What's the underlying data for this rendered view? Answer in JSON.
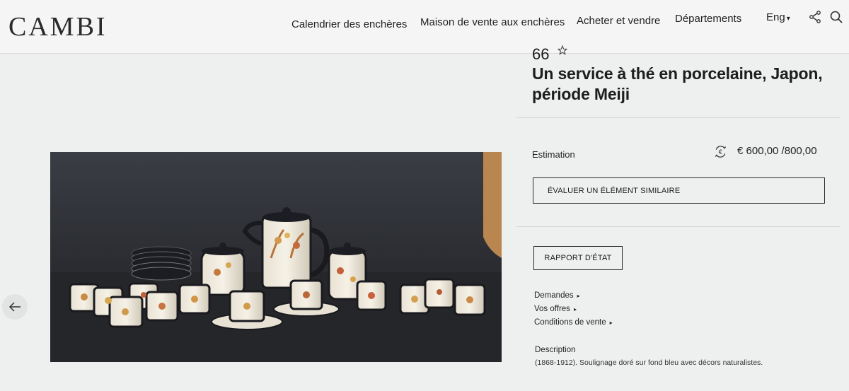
{
  "header": {
    "logo": "CAMBI",
    "nav": [
      {
        "label": "Calendrier des enchères"
      },
      {
        "label": "Maison de vente aux enchères"
      },
      {
        "label": "Acheter et vendre"
      },
      {
        "label": "Départements"
      }
    ],
    "language": "Eng",
    "icons": [
      "share-icon",
      "search-icon"
    ]
  },
  "lot": {
    "number": "66",
    "title": "Un service à thé en porcelaine, Japon, période Meiji",
    "estimate_label": "Estimation",
    "estimate_value": "€ 600,00 /800,00",
    "similar_button": "ÉVALUER UN ÉLÉMENT SIMILAIRE",
    "report_button": "RAPPORT D'ÉTAT",
    "links": [
      {
        "label": "Demandes"
      },
      {
        "label": "Vos offres"
      },
      {
        "label": "Conditions de vente"
      }
    ],
    "description_title": "Description",
    "description_text": "(1868-1912). Soulignage doré sur fond bleu avec décors naturalistes."
  },
  "colors": {
    "background": "#eef0ef",
    "text": "#1b1b1b",
    "button_border": "#2a2a2a"
  }
}
